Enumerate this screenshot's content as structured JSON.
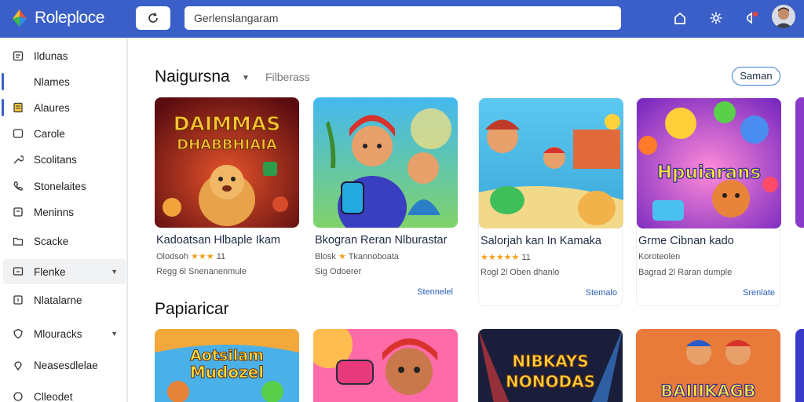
{
  "header": {
    "brand": "Roleploce",
    "search_value": "Gerlenslangaram",
    "colors": {
      "bar": "#3a5fc8"
    },
    "icons": [
      "home-icon",
      "settings-icon",
      "notifications-icon"
    ]
  },
  "sidebar": {
    "items": [
      {
        "label": "Ildunas",
        "icon": "calendar-icon"
      },
      {
        "label": "Nlames",
        "icon": "none"
      },
      {
        "label": "Alaures",
        "icon": "document-icon"
      },
      {
        "label": "Carole",
        "icon": "chat-icon"
      },
      {
        "label": "Scolitans",
        "icon": "wrench-icon"
      },
      {
        "label": "Stonelaites",
        "icon": "phone-icon"
      },
      {
        "label": "Meninns",
        "icon": "square-icon"
      },
      {
        "label": "Scacke",
        "icon": "folder-icon"
      },
      {
        "label": "Flenke",
        "icon": "screen-icon",
        "active": true
      },
      {
        "label": "Nlatalarne",
        "icon": "square-icon"
      },
      {
        "label": "Mlouracks",
        "icon": "shield-icon"
      },
      {
        "label": "Neasesdlelae",
        "icon": "pin-icon"
      },
      {
        "label": "Clleodet",
        "icon": "circle-icon"
      }
    ]
  },
  "main": {
    "section1_title": "Naigursna",
    "filter_label": "Filberass",
    "see_all": "Saman",
    "section2_title": "Papiaricar",
    "cards": [
      {
        "thumb_text_1": "DAIMMAS",
        "thumb_text_2": "DHABBHIAIA",
        "title": "Kadoatsan Hlbaple Ikam",
        "meta": "Olodsoh",
        "stars": "★★★",
        "rating": "11",
        "sub": "Regg 6l Snenanenmule",
        "action": ""
      },
      {
        "thumb_text_1": "",
        "thumb_text_2": "",
        "title": "Bkogran Reran Nlburastar",
        "meta": "Blosk",
        "stars": "★",
        "rating": "Tkannoboata",
        "sub": "Sig Odoerer",
        "action": "Stennelel"
      },
      {
        "thumb_text_1": "",
        "thumb_text_2": "",
        "title": "Salorjah kan In Kamaka",
        "meta": "",
        "stars": "★★★★★",
        "rating": "11",
        "sub": "Rogl 2l Oben dhanlo",
        "action": "Stemalo"
      },
      {
        "thumb_text_1": "Hpuiarans",
        "thumb_text_2": "",
        "title": "Grme Cibnan kado",
        "meta": "Koroteolen",
        "stars": "",
        "rating": "",
        "sub": "Bagrad 2l Raran dumple",
        "action": "Srenlate"
      }
    ],
    "row2": [
      {
        "thumb_text_1": "Aotsilam",
        "thumb_text_2": "Mudozel"
      },
      {
        "thumb_text_1": "",
        "thumb_text_2": ""
      },
      {
        "thumb_text_1": "NIBKAYS",
        "thumb_text_2": "NONODAS"
      },
      {
        "thumb_text_1": "BAIIIKAGB",
        "thumb_text_2": ""
      }
    ]
  }
}
